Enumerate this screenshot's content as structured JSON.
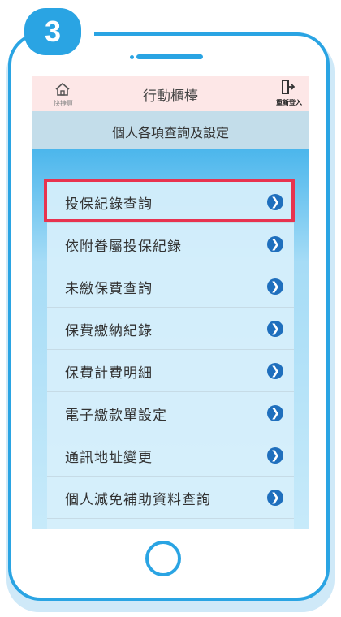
{
  "step_number": "3",
  "header": {
    "home_label": "快捷頁",
    "title": "行動櫃檯",
    "logout_label": "重新登入"
  },
  "section_title": "個人各項查詢及設定",
  "menu": {
    "items": [
      {
        "label": "投保紀錄查詢",
        "highlighted": true
      },
      {
        "label": "依附眷屬投保紀錄"
      },
      {
        "label": "未繳保費查詢"
      },
      {
        "label": "保費繳納紀錄"
      },
      {
        "label": "保費計費明細"
      },
      {
        "label": "電子繳款單設定"
      },
      {
        "label": "通訊地址變更"
      },
      {
        "label": "個人減免補助資料查詢"
      }
    ],
    "arrow_glyph": "❯"
  },
  "colors": {
    "frame": "#2aa4e3",
    "highlight": "#e8334f",
    "arrow": "#1f6fbd",
    "topbar": "#fde7e7",
    "subheader": "#c3ddea"
  }
}
